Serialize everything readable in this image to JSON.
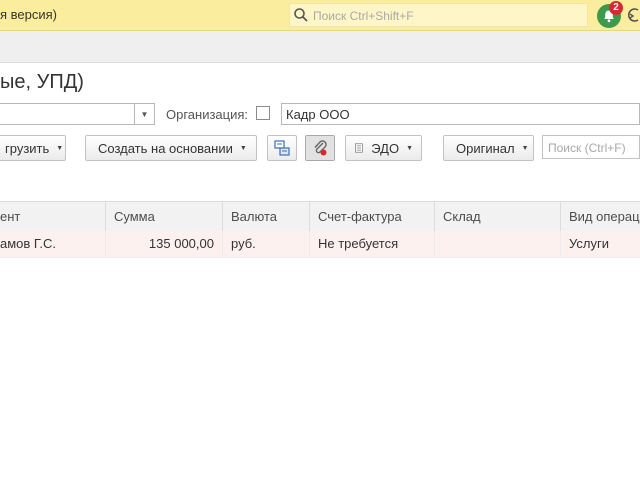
{
  "header": {
    "app_title": "я версия)",
    "search_placeholder": "Поиск Ctrl+Shift+F",
    "notifications_count": "2"
  },
  "page": {
    "title": "ые, УПД)"
  },
  "filters": {
    "organization_label": "Организация:",
    "organization_value": "Кадр ООО"
  },
  "toolbar": {
    "upload_label": "грузить",
    "create_based_label": "Создать на основании",
    "edo_label": "ЭДО",
    "original_label": "Оригинал",
    "search_placeholder": "Поиск (Ctrl+F)"
  },
  "table": {
    "columns": [
      "ент",
      "Сумма",
      "Валюта",
      "Счет-фактура",
      "Склад",
      "Вид операц"
    ],
    "rows": [
      [
        "амов Г.С.",
        "135 000,00",
        "руб.",
        "Не требуется",
        "",
        "Услуги"
      ]
    ]
  },
  "colors": {
    "topbar": "#fbed9e",
    "notification_green": "#3d9a4b",
    "badge_red": "#d9282f",
    "selected_row": "#fdf1f0"
  }
}
